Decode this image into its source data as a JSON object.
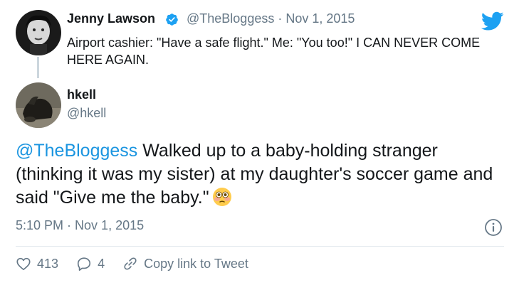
{
  "parent": {
    "name": "Jenny Lawson",
    "handle": "@TheBloggess",
    "separator": "·",
    "date": "Nov 1, 2015",
    "text": "Airport cashier: \"Have a safe flight.\" Me: \"You too!\"  I CAN NEVER COME HERE AGAIN."
  },
  "reply": {
    "name": "hkell",
    "handle": "@hkell",
    "mention": "@TheBloggess",
    "text": " Walked up to a baby-holding stranger (thinking it was my sister) at my daughter's soccer game and said \"Give me the baby.\"",
    "emoji": "flushed-face",
    "time": "5:10 PM",
    "separator": "·",
    "date": "Nov 1, 2015"
  },
  "actions": {
    "likes": "413",
    "replies": "4",
    "copy_link": "Copy link to Tweet"
  },
  "colors": {
    "twitter_blue": "#1da1f2",
    "mention": "#1b95e0",
    "secondary_text": "#657786",
    "divider": "#e1e8ed",
    "thread_line": "#ccd6dd"
  },
  "icons": [
    "twitter-bird-icon",
    "verified-badge-icon",
    "info-icon",
    "heart-icon",
    "reply-icon",
    "link-icon"
  ]
}
